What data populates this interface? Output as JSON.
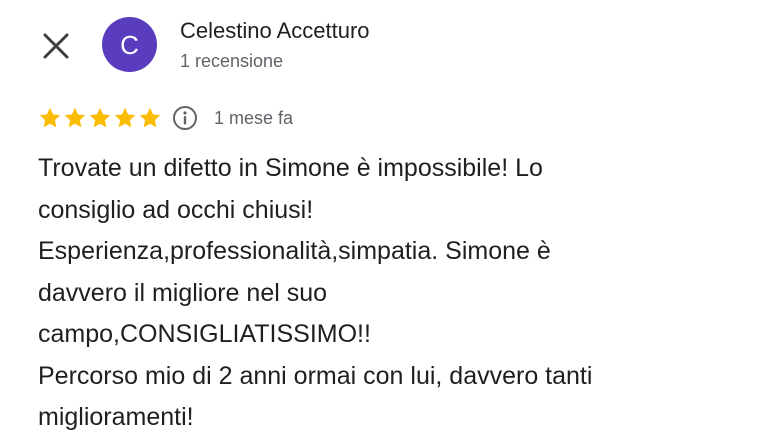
{
  "header": {
    "close_icon": "close-icon",
    "avatar_letter": "C",
    "avatar_color": "#5a3dbf",
    "author_name": "Celestino Accetturo",
    "author_meta": "1 recensione"
  },
  "rating": {
    "stars": 5,
    "max_stars": 5,
    "star_color": "#fbbc04",
    "info_icon": "info-icon",
    "date": "1 mese fa"
  },
  "review": {
    "lines": [
      "Trovate un difetto in Simone è impossibile! Lo",
      "consiglio ad occhi chiusi!",
      "Esperienza,professionalità,simpatia. Simone è",
      "davvero il migliore nel suo",
      "campo,CONSIGLIATISSIMO!!",
      "Percorso mio di 2 anni ormai con lui, davvero tanti",
      "miglioramenti!"
    ]
  }
}
